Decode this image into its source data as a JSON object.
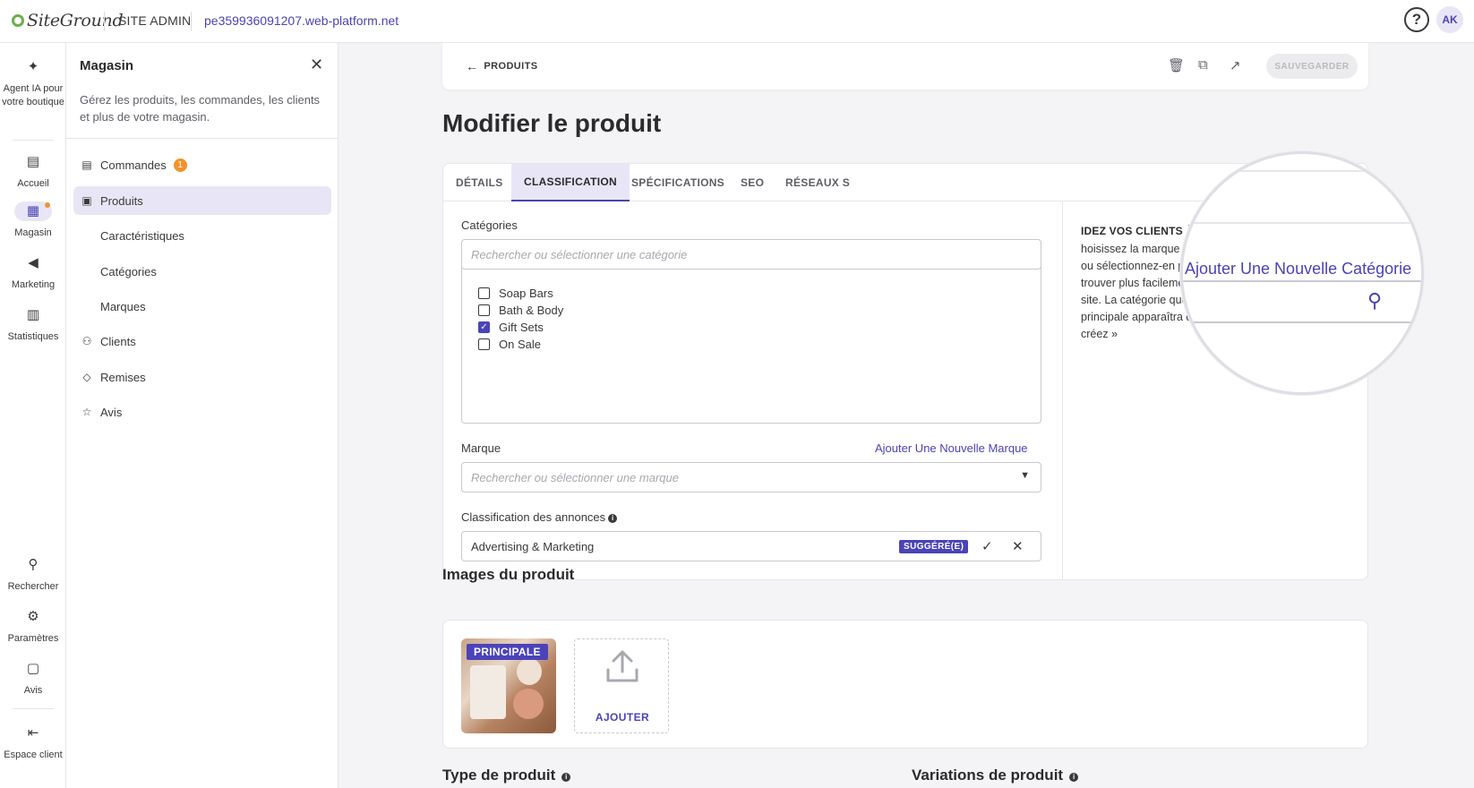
{
  "topbar": {
    "logo": "SiteGround",
    "site_admin": "SITE ADMIN",
    "domain": "pe359936091207.web-platform.net",
    "help": "?",
    "avatar": "AK"
  },
  "rail": {
    "items": [
      {
        "label": "Agent IA pour votre boutique",
        "icon": "sparkle-icon"
      },
      {
        "label": "Accueil",
        "icon": "home-icon"
      },
      {
        "label": "Magasin",
        "icon": "store-icon"
      },
      {
        "label": "Marketing",
        "icon": "megaphone-icon"
      },
      {
        "label": "Statistiques",
        "icon": "stats-icon"
      },
      {
        "label": "Rechercher",
        "icon": "search-icon"
      },
      {
        "label": "Paramètres",
        "icon": "gear-icon"
      },
      {
        "label": "Avis",
        "icon": "review-icon"
      },
      {
        "label": "Espace client",
        "icon": "exit-icon"
      }
    ]
  },
  "panel": {
    "title": "Magasin",
    "description": "Gérez les produits, les commandes, les clients et plus de votre magasin.",
    "nav": [
      {
        "label": "Commandes",
        "badge": "1"
      },
      {
        "label": "Produits"
      },
      {
        "label": "Caractéristiques"
      },
      {
        "label": "Catégories"
      },
      {
        "label": "Marques"
      },
      {
        "label": "Clients"
      },
      {
        "label": "Remises"
      },
      {
        "label": "Avis"
      }
    ]
  },
  "actionbar": {
    "back_label": "PRODUITS",
    "save_label": "SAUVEGARDER"
  },
  "page": {
    "title": "Modifier le produit"
  },
  "tabs": [
    "DÉTAILS",
    "CLASSIFICATION",
    "SPÉCIFICATIONS",
    "SEO",
    "RÉSEAUX S"
  ],
  "classification": {
    "categories_label": "Catégories",
    "categories_placeholder": "Rechercher ou sélectionner une catégorie",
    "add_category_link": "Ajouter Une Nouvelle Catégorie",
    "categories": [
      {
        "name": "Soap Bars",
        "checked": false
      },
      {
        "name": "Bath & Body",
        "checked": false
      },
      {
        "name": "Gift Sets",
        "checked": true
      },
      {
        "name": "On Sale",
        "checked": false
      }
    ],
    "brand_label": "Marque",
    "add_brand_link": "Ajouter Une Nouvelle Marque",
    "brand_placeholder": "Rechercher ou sélectionner une marque",
    "ads_label": "Classification des annonces",
    "ads_value": "Advertising & Marketing",
    "ads_badge": "SUGGÉRÉ(E)"
  },
  "help": {
    "title": "IDEZ VOS CLIENTS À TROUVER VOTRE PRODUIT",
    "text": "hoisissez la marque et la catégorie de votre produit ou sélectionnez-en plusieurs) pour aider vos clients à trouver plus facilement ce qu'ils recherchent sur votre site. La catégorie que vous sélectionnez comme principale apparaîtra dans l'URL du produit que vous créez »"
  },
  "images": {
    "title": "Images du produit",
    "main_badge": "PRINCIPALE",
    "add_label": "AJOUTER"
  },
  "footer_sections": {
    "product_type": "Type de produit",
    "variations": "Variations de produit"
  },
  "colors": {
    "accent": "#4b43b8",
    "badge": "#f0932b",
    "active_bg": "#e8e6f6"
  }
}
